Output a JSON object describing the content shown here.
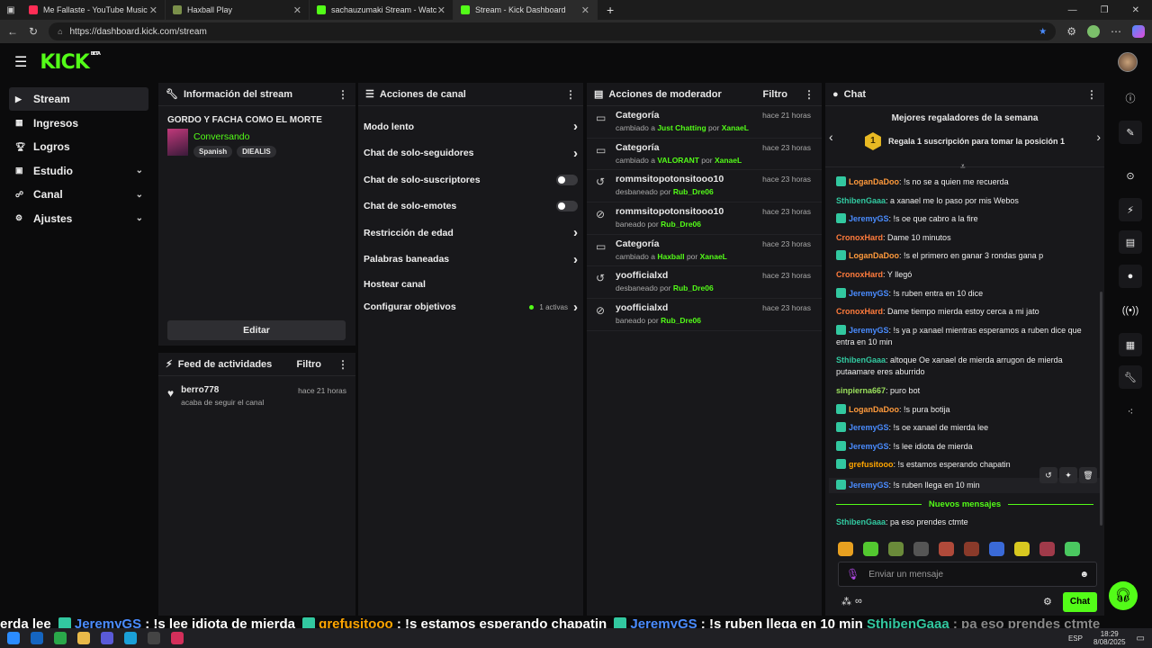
{
  "browser": {
    "tabs": [
      {
        "title": "Me Fallaste - YouTube Music",
        "color": "#ff2d55"
      },
      {
        "title": "Haxball Play",
        "color": "#7a8f4a"
      },
      {
        "title": "sachauzumaki Stream - Watc",
        "color": "#53fc18"
      },
      {
        "title": "Stream - Kick Dashboard",
        "color": "#53fc18"
      }
    ],
    "url": "https://dashboard.kick.com/stream"
  },
  "brand": {
    "logo": "KICK",
    "beta": "BETA",
    "accent": "#53fc18"
  },
  "sidebar": {
    "items": [
      {
        "label": "Stream",
        "icon": "play-icon"
      },
      {
        "label": "Ingresos",
        "icon": "coins-icon"
      },
      {
        "label": "Logros",
        "icon": "trophy-icon"
      },
      {
        "label": "Estudio",
        "icon": "studio-icon"
      },
      {
        "label": "Canal",
        "icon": "channel-icon"
      },
      {
        "label": "Ajustes",
        "icon": "gear-icon"
      }
    ]
  },
  "stream_info": {
    "header": "Información del stream",
    "title": "GORDO Y FACHA COMO EL MORTE",
    "category": "Conversando",
    "tags": [
      "Spanish",
      "DIEALIS"
    ],
    "edit_label": "Editar"
  },
  "feed": {
    "header": "Feed de actividades",
    "filter": "Filtro",
    "items": [
      {
        "user": "berro778",
        "action": "acaba de seguir el canal",
        "time": "hace 21 horas"
      }
    ]
  },
  "channel_actions": {
    "header": "Acciones de canal",
    "items": [
      {
        "label": "Modo lento",
        "control": "chevron"
      },
      {
        "label": "Chat de solo-seguidores",
        "control": "chevron"
      },
      {
        "label": "Chat de solo-suscriptores",
        "control": "toggle"
      },
      {
        "label": "Chat de solo-emotes",
        "control": "toggle"
      },
      {
        "label": "Restricción de edad",
        "control": "chevron"
      },
      {
        "label": "Palabras baneadas",
        "control": "chevron"
      },
      {
        "label": "Hostear canal",
        "control": "none"
      },
      {
        "label": "Configurar objetivos",
        "control": "chevron",
        "status": "1 activas"
      }
    ]
  },
  "mod_actions": {
    "header": "Acciones de moderador",
    "filter": "Filtro",
    "items": [
      {
        "title": "Categoría",
        "pre": "cambiado a",
        "target": "Just Chatting",
        "mid": "por",
        "by": "XanaeL",
        "time": "hace 21 horas",
        "icon": "category-icon"
      },
      {
        "title": "Categoría",
        "pre": "cambiado a",
        "target": "VALORANT",
        "mid": "por",
        "by": "XanaeL",
        "time": "hace 23 horas",
        "icon": "category-icon"
      },
      {
        "title": "rommsitopotonsitooo10",
        "pre": "desbaneado por",
        "target": "",
        "mid": "",
        "by": "Rub_Dre06",
        "time": "hace 23 horas",
        "icon": "unban-icon"
      },
      {
        "title": "rommsitopotonsitooo10",
        "pre": "baneado por",
        "target": "",
        "mid": "",
        "by": "Rub_Dre06",
        "time": "hace 23 horas",
        "icon": "ban-icon"
      },
      {
        "title": "Categoría",
        "pre": "cambiado a",
        "target": "Haxball",
        "mid": "por",
        "by": "XanaeL",
        "time": "hace 23 horas",
        "icon": "category-icon"
      },
      {
        "title": "yoofficialxd",
        "pre": "desbaneado por",
        "target": "",
        "mid": "",
        "by": "Rub_Dre06",
        "time": "hace 23 horas",
        "icon": "unban-icon"
      },
      {
        "title": "yoofficialxd",
        "pre": "baneado por",
        "target": "",
        "mid": "",
        "by": "Rub_Dre06",
        "time": "hace 23 horas",
        "icon": "ban-icon"
      }
    ]
  },
  "chat": {
    "header": "Chat",
    "gifters_title": "Mejores regaladores de la semana",
    "gifters_rank": "1",
    "gifters_text": "Regala 1 suscripción para tomar la posición 1",
    "messages": [
      {
        "user": "LoganDaDoo",
        "text": "!s no se a quien me recuerda",
        "color": "#ff9a3c",
        "badge": true
      },
      {
        "user": "SthibenGaaa",
        "text": "a xanael me lo paso por mis Webos",
        "color": "#32c8a0",
        "badge": false
      },
      {
        "user": "JeremyGS",
        "text": "!s oe que cabro a la fire",
        "color": "#4a8cff",
        "badge": true
      },
      {
        "user": "CronoxHard",
        "text": "Dame 10 minutos",
        "color": "#ff7b3c",
        "badge": false
      },
      {
        "user": "LoganDaDoo",
        "text": "!s el primero en ganar 3 rondas gana p",
        "color": "#ff9a3c",
        "badge": true
      },
      {
        "user": "CronoxHard",
        "text": "Y llegó",
        "color": "#ff7b3c",
        "badge": false
      },
      {
        "user": "JeremyGS",
        "text": "!s ruben entra en 10 dice",
        "color": "#4a8cff",
        "badge": true
      },
      {
        "user": "CronoxHard",
        "text": "Dame tiempo mierda estoy cerca a mi jato",
        "color": "#ff7b3c",
        "badge": false
      },
      {
        "user": "JeremyGS",
        "text": "!s ya p xanael mientras esperamos a ruben dice que entra en 10 min",
        "color": "#4a8cff",
        "badge": true
      },
      {
        "user": "SthibenGaaa",
        "text": "altoque Oe xanael de mierda arrugon de mierda putaamare eres aburrido",
        "color": "#32c8a0",
        "badge": false
      },
      {
        "user": "sinpierna667",
        "text": "puro bot",
        "color": "#9be15d",
        "badge": false
      },
      {
        "user": "LoganDaDoo",
        "text": "!s pura botija",
        "color": "#ff9a3c",
        "badge": true
      },
      {
        "user": "JeremyGS",
        "text": "!s oe xanael de mierda lee",
        "color": "#4a8cff",
        "badge": true
      },
      {
        "user": "JeremyGS",
        "text": "!s lee idiota de mierda",
        "color": "#4a8cff",
        "badge": true
      },
      {
        "user": "grefusitooo",
        "text": "!s estamos esperando chapatin",
        "color": "#ffa500",
        "badge": true
      },
      {
        "user": "JeremyGS",
        "text": "!s ruben llega en 10 min",
        "color": "#4a8cff",
        "badge": true
      }
    ],
    "new_messages_label": "Nuevos mensajes",
    "after": [
      {
        "user": "SthibenGaaa",
        "text": "pa eso prendes ctmte",
        "color": "#32c8a0"
      }
    ],
    "input_placeholder": "Enviar un mensaje",
    "send_label": "Chat"
  },
  "ticker": [
    {
      "text": "erda lee ",
      "color": "#ffffff"
    },
    {
      "text": "JeremyGS",
      "color": "#4a8cff",
      "badge": true
    },
    {
      "text": " : !s lee idiota de mierda ",
      "color": "#ffffff"
    },
    {
      "text": "grefusitooo",
      "color": "#ffa500",
      "badge": true
    },
    {
      "text": " : !s estamos esperando chapatin ",
      "color": "#ffffff"
    },
    {
      "text": "JeremyGS",
      "color": "#4a8cff",
      "badge": true
    },
    {
      "text": " : !s ruben llega en 10 min ",
      "color": "#ffffff"
    },
    {
      "text": "SthibenGaaa",
      "color": "#32c8a0"
    },
    {
      "text": " : pa eso prendes ctmte",
      "color": "#888888"
    }
  ],
  "taskbar": {
    "lang": "ESP",
    "time": "18:29",
    "date": "8/08/2025"
  }
}
